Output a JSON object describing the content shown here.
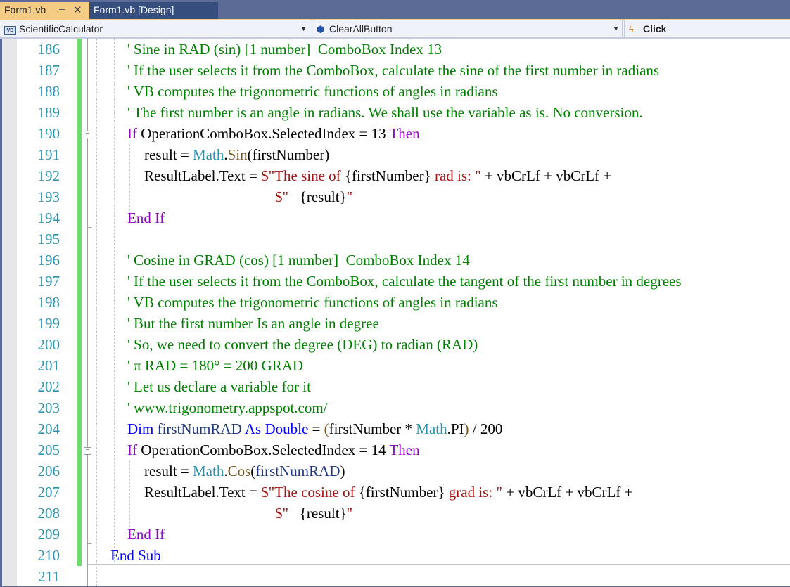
{
  "tabs": [
    {
      "label": "Form1.vb",
      "active": true,
      "pin_icon": "pin-icon",
      "close_icon": "close-icon"
    },
    {
      "label": "Form1.vb [Design]",
      "active": false
    }
  ],
  "navbar": {
    "project": {
      "icon": "vb-project-icon",
      "label": "ScientificCalculator"
    },
    "object": {
      "icon": "object-icon",
      "label": "ClearAllButton"
    },
    "member": {
      "icon": "event-bolt-icon",
      "label": "Click"
    }
  },
  "colors": {
    "comment": "#008000",
    "keyword": "#0000ff",
    "control_keyword": "#8f08c4",
    "string": "#a31515",
    "type": "#2b91af",
    "method": "#74531f",
    "line_number": "#2b91af",
    "change_bar": "#6cdd6c",
    "active_tab": "#f5cc84"
  },
  "lines": [
    {
      "n": "186",
      "indent": 1,
      "tokens": [
        {
          "t": "cm",
          "v": "' Sine in RAD (sin) [1 number]  ComboBox Index 13"
        }
      ]
    },
    {
      "n": "187",
      "indent": 1,
      "tokens": [
        {
          "t": "cm",
          "v": "' If the user selects it from the ComboBox, calculate the sine of the first number in radians"
        }
      ]
    },
    {
      "n": "188",
      "indent": 1,
      "tokens": [
        {
          "t": "cm",
          "v": "' VB computes the trigonometric functions of angles in radians"
        }
      ]
    },
    {
      "n": "189",
      "indent": 1,
      "tokens": [
        {
          "t": "cm",
          "v": "' The first number is an angle in radians. We shall use the variable as is. No conversion."
        }
      ]
    },
    {
      "n": "190",
      "indent": 1,
      "tokens": [
        {
          "t": "ctl",
          "v": "If"
        },
        {
          "t": "pl",
          "v": " OperationComboBox.SelectedIndex = 13 "
        },
        {
          "t": "ctl",
          "v": "Then"
        }
      ]
    },
    {
      "n": "191",
      "indent": 2,
      "tokens": [
        {
          "t": "pl",
          "v": "result = "
        },
        {
          "t": "typ",
          "v": "Math"
        },
        {
          "t": "pl",
          "v": "."
        },
        {
          "t": "fn",
          "v": "Sin"
        },
        {
          "t": "pl",
          "v": "(firstNumber)"
        }
      ]
    },
    {
      "n": "192",
      "indent": 2,
      "tokens": [
        {
          "t": "pl",
          "v": "ResultLabel.Text = "
        },
        {
          "t": "str",
          "v": "$\"The sine of "
        },
        {
          "t": "pl",
          "v": "{firstNumber}"
        },
        {
          "t": "str",
          "v": " rad is: \""
        },
        {
          "t": "pl",
          "v": " + vbCrLf + vbCrLf +"
        }
      ]
    },
    {
      "n": "193",
      "indent": 3,
      "tokens": [
        {
          "t": "str",
          "v": "$\"   "
        },
        {
          "t": "pl",
          "v": "{result}"
        },
        {
          "t": "str",
          "v": "\""
        }
      ]
    },
    {
      "n": "194",
      "indent": 1,
      "tokens": [
        {
          "t": "ctl",
          "v": "End If"
        }
      ]
    },
    {
      "n": "195",
      "indent": 1,
      "tokens": []
    },
    {
      "n": "196",
      "indent": 1,
      "tokens": [
        {
          "t": "cm",
          "v": "' Cosine in GRAD (cos) [1 number]  ComboBox Index 14"
        }
      ]
    },
    {
      "n": "197",
      "indent": 1,
      "tokens": [
        {
          "t": "cm",
          "v": "' If the user selects it from the ComboBox, calculate the tangent of the first number in degrees"
        }
      ]
    },
    {
      "n": "198",
      "indent": 1,
      "tokens": [
        {
          "t": "cm",
          "v": "' VB computes the trigonometric functions of angles in radians"
        }
      ]
    },
    {
      "n": "199",
      "indent": 1,
      "tokens": [
        {
          "t": "cm",
          "v": "' But the first number Is an angle in degree"
        }
      ]
    },
    {
      "n": "200",
      "indent": 1,
      "tokens": [
        {
          "t": "cm",
          "v": "' So, we need to convert the degree (DEG) to radian (RAD)"
        }
      ]
    },
    {
      "n": "201",
      "indent": 1,
      "tokens": [
        {
          "t": "cm",
          "v": "' π RAD = 180° = 200 GRAD"
        }
      ]
    },
    {
      "n": "202",
      "indent": 1,
      "tokens": [
        {
          "t": "cm",
          "v": "' Let us declare a variable for it"
        }
      ]
    },
    {
      "n": "203",
      "indent": 1,
      "tokens": [
        {
          "t": "cm",
          "v": "' www.trigonometry.appspot.com/"
        }
      ]
    },
    {
      "n": "204",
      "indent": 1,
      "tokens": [
        {
          "t": "kw",
          "v": "Dim"
        },
        {
          "t": "lc",
          "v": " firstNumRAD "
        },
        {
          "t": "kw",
          "v": "As Double"
        },
        {
          "t": "pl",
          "v": " = "
        },
        {
          "t": "fn",
          "v": "("
        },
        {
          "t": "pl",
          "v": "firstNumber * "
        },
        {
          "t": "typ",
          "v": "Math"
        },
        {
          "t": "pl",
          "v": ".PI"
        },
        {
          "t": "fn",
          "v": ")"
        },
        {
          "t": "pl",
          "v": " / 200"
        }
      ]
    },
    {
      "n": "205",
      "indent": 1,
      "tokens": [
        {
          "t": "ctl",
          "v": "If"
        },
        {
          "t": "pl",
          "v": " OperationComboBox.SelectedIndex = 14 "
        },
        {
          "t": "ctl",
          "v": "Then"
        }
      ]
    },
    {
      "n": "206",
      "indent": 2,
      "tokens": [
        {
          "t": "pl",
          "v": "result = "
        },
        {
          "t": "typ",
          "v": "Math"
        },
        {
          "t": "pl",
          "v": "."
        },
        {
          "t": "fn",
          "v": "Cos"
        },
        {
          "t": "pl",
          "v": "("
        },
        {
          "t": "lc",
          "v": "firstNumRAD"
        },
        {
          "t": "pl",
          "v": ")"
        }
      ]
    },
    {
      "n": "207",
      "indent": 2,
      "tokens": [
        {
          "t": "pl",
          "v": "ResultLabel.Text = "
        },
        {
          "t": "str",
          "v": "$\"The cosine of "
        },
        {
          "t": "pl",
          "v": "{firstNumber}"
        },
        {
          "t": "str",
          "v": " grad is: \""
        },
        {
          "t": "pl",
          "v": " + vbCrLf + vbCrLf +"
        }
      ]
    },
    {
      "n": "208",
      "indent": 3,
      "tokens": [
        {
          "t": "str",
          "v": "$\"   "
        },
        {
          "t": "pl",
          "v": "{result}"
        },
        {
          "t": "str",
          "v": "\""
        }
      ]
    },
    {
      "n": "209",
      "indent": 1,
      "tokens": [
        {
          "t": "ctl",
          "v": "End If"
        }
      ]
    },
    {
      "n": "210",
      "indent": 0,
      "tokens": [
        {
          "t": "kw",
          "v": "End Sub"
        }
      ]
    },
    {
      "n": "211",
      "indent": 0,
      "tokens": []
    }
  ]
}
